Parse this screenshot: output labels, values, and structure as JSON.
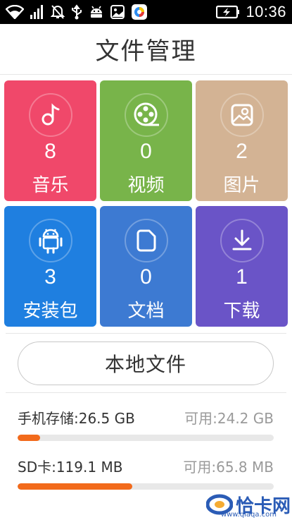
{
  "status_bar": {
    "time": "10:36",
    "icons_left": [
      "wifi-icon",
      "signal-icon",
      "mute-icon",
      "usb-icon",
      "android-debug-icon",
      "gallery-icon",
      "app-icon"
    ],
    "icons_right": [
      "battery-charging-icon"
    ]
  },
  "header": {
    "title": "文件管理"
  },
  "categories": [
    {
      "id": "music",
      "label": "音乐",
      "count": "8",
      "color": "#f0486a",
      "icon": "music-note-icon"
    },
    {
      "id": "video",
      "label": "视频",
      "count": "0",
      "color": "#78b44a",
      "icon": "film-reel-icon"
    },
    {
      "id": "image",
      "label": "图片",
      "count": "2",
      "color": "#d3b394",
      "icon": "picture-icon"
    },
    {
      "id": "apk",
      "label": "安装包",
      "count": "3",
      "color": "#1f7fe0",
      "icon": "android-icon"
    },
    {
      "id": "doc",
      "label": "文档",
      "count": "0",
      "color": "#3d7ad2",
      "icon": "document-icon"
    },
    {
      "id": "download",
      "label": "下载",
      "count": "1",
      "color": "#6a54c7",
      "icon": "download-icon"
    }
  ],
  "local_files_button": {
    "label": "本地文件"
  },
  "storage": [
    {
      "name": "手机存储:26.5 GB",
      "available": "可用:24.2 GB",
      "used_fraction": 0.087,
      "bar_color": "#f26a1b"
    },
    {
      "name": "SD卡:119.1 MB",
      "available": "可用:65.8 MB",
      "used_fraction": 0.448,
      "bar_color": "#f26a1b"
    }
  ],
  "watermark": {
    "text": "恰卡网",
    "sub": "www.qiaqa.com"
  }
}
